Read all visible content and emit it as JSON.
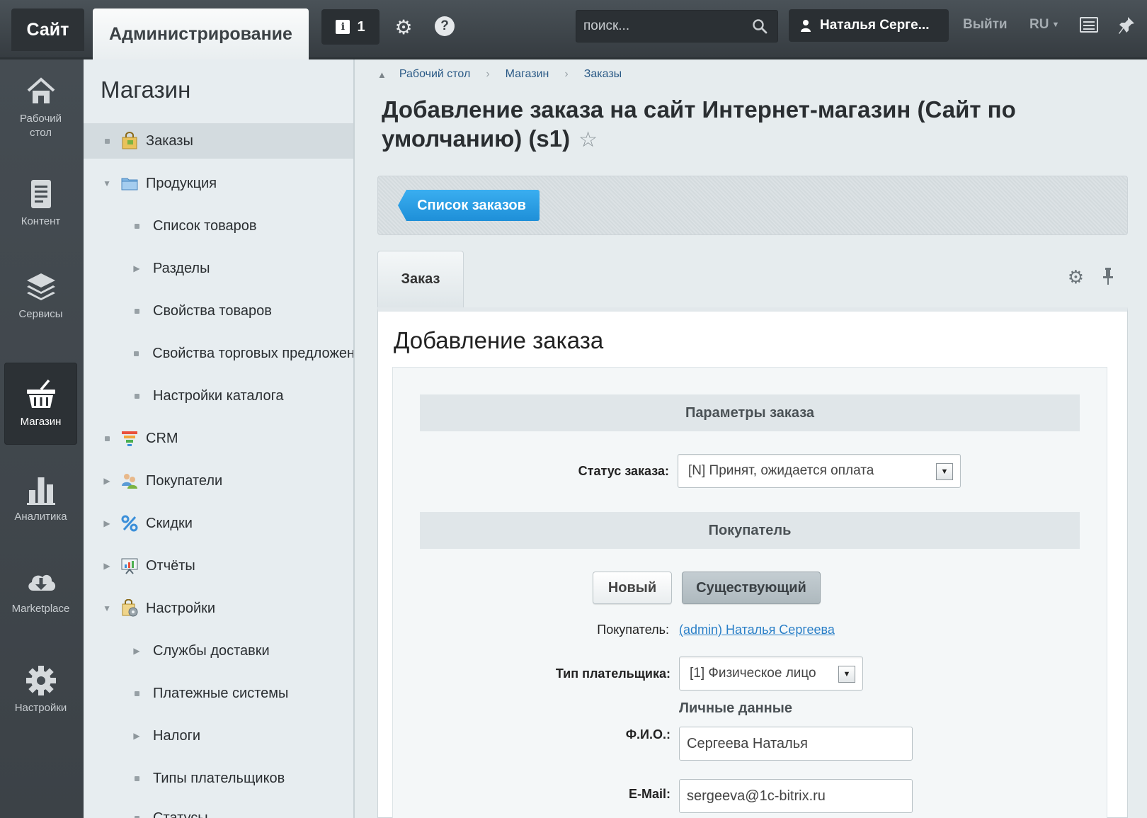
{
  "topbar": {
    "site_tab": "Сайт",
    "admin_tab": "Администрирование",
    "notifications_count": "1",
    "search_placeholder": "поиск...",
    "user_name": "Наталья Серге...",
    "logout": "Выйти",
    "language": "RU"
  },
  "rail": {
    "items": [
      {
        "label": "Рабочий стол",
        "icon": "home-icon"
      },
      {
        "label": "Контент",
        "icon": "document-icon"
      },
      {
        "label": "Сервисы",
        "icon": "layers-icon"
      },
      {
        "label": "Магазин",
        "icon": "basket-icon"
      },
      {
        "label": "Аналитика",
        "icon": "bar-chart-icon"
      },
      {
        "label": "Marketplace",
        "icon": "cloud-download-icon"
      },
      {
        "label": "Настройки",
        "icon": "gear-icon"
      }
    ]
  },
  "menu": {
    "title": "Магазин",
    "items": [
      {
        "label": "Заказы"
      },
      {
        "label": "Продукция"
      },
      {
        "label": "Список товаров"
      },
      {
        "label": "Разделы"
      },
      {
        "label": "Свойства товаров"
      },
      {
        "label": "Свойства торговых предложен"
      },
      {
        "label": "Настройки каталога"
      },
      {
        "label": "CRM"
      },
      {
        "label": "Покупатели"
      },
      {
        "label": "Скидки"
      },
      {
        "label": "Отчёты"
      },
      {
        "label": "Настройки"
      },
      {
        "label": "Службы доставки"
      },
      {
        "label": "Платежные системы"
      },
      {
        "label": "Налоги"
      },
      {
        "label": "Типы плательщиков"
      },
      {
        "label": "Статусы"
      }
    ]
  },
  "breadcrumbs": [
    "Рабочий стол",
    "Магазин",
    "Заказы"
  ],
  "page": {
    "title": "Добавление заказа на сайт Интернет-магазин (Сайт по умолчанию) (s1)",
    "list_button": "Список заказов",
    "tab_label": "Заказ",
    "form_title": "Добавление заказа"
  },
  "form": {
    "section_params": "Параметры заказа",
    "status_label": "Статус заказа:",
    "status_value": "[N] Принят, ожидается оплата",
    "section_buyer": "Покупатель",
    "btn_new": "Новый",
    "btn_existing": "Существующий",
    "buyer_label": "Покупатель:",
    "buyer_value": "(admin) Наталья Сергеева",
    "payer_type_label": "Тип плательщика:",
    "payer_type_value": "[1] Физическое лицо",
    "personal_data": "Личные данные",
    "fio_label": "Ф.И.О.:",
    "fio_value": "Сергеева Наталья",
    "email_label": "E-Mail:",
    "email_value": "sergeeva@1c-bitrix.ru"
  }
}
